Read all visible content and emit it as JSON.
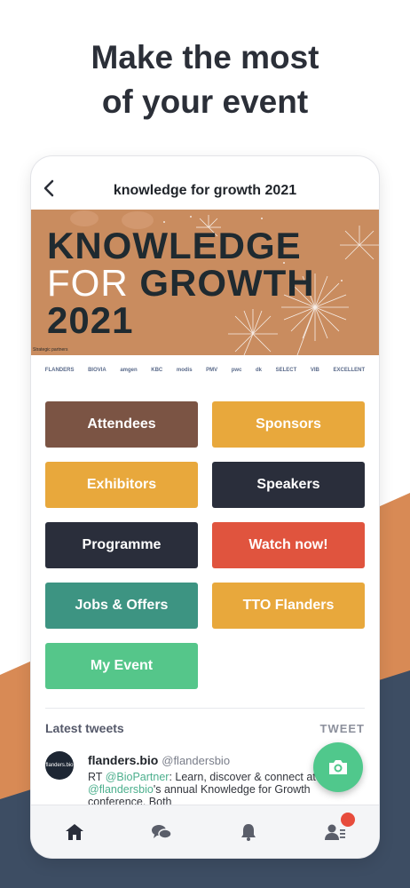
{
  "headline": {
    "line1": "Make the most",
    "line2": "of your event"
  },
  "header": {
    "title": "knowledge for growth 2021"
  },
  "banner": {
    "line1": "KNOWLEDGE",
    "line2_for": "FOR",
    "line2_growth": "GROWTH",
    "line3": "2021",
    "strategic": "Strategic partners",
    "partners": [
      "FLANDERS",
      "BIOVIA",
      "amgen",
      "KBC",
      "modis",
      "PMV",
      "pwc",
      "dk",
      "SELECT",
      "VIB",
      "EXCELLENT"
    ]
  },
  "tiles": [
    {
      "label": "Attendees",
      "color": "#7b5444"
    },
    {
      "label": "Sponsors",
      "color": "#e8a83c"
    },
    {
      "label": "Exhibitors",
      "color": "#e8a83c"
    },
    {
      "label": "Speakers",
      "color": "#2a2e3b"
    },
    {
      "label": "Programme",
      "color": "#2a2e3b"
    },
    {
      "label": "Watch now!",
      "color": "#e0543e"
    },
    {
      "label": "Jobs & Offers",
      "color": "#3d9482"
    },
    {
      "label": "TTO Flanders",
      "color": "#e8a83c"
    },
    {
      "label": "My Event",
      "color": "#55c68a"
    }
  ],
  "tweets": {
    "title": "Latest tweets",
    "link": "TWEET",
    "item": {
      "avatar_text": "flanders.bio",
      "name": "flanders.bio",
      "handle": "@flandersbio",
      "text_rt": "RT ",
      "mention1": "@BioPartner",
      "text_mid": ": Learn, discover & connect at ",
      "mention2": "@flandersbio",
      "text_end": "'s annual Knowledge for Growth conference. Both"
    }
  },
  "colors": {
    "background_orange": "#d88a55",
    "background_navy": "#3d4d63",
    "fab": "#50c88c",
    "badge": "#e74c3c"
  },
  "icons": {
    "back": "chevron-left-icon",
    "fab": "camera-icon",
    "tab1": "home-icon",
    "tab2": "chat-icon",
    "tab3": "bell-icon",
    "tab4": "profile-icon"
  }
}
